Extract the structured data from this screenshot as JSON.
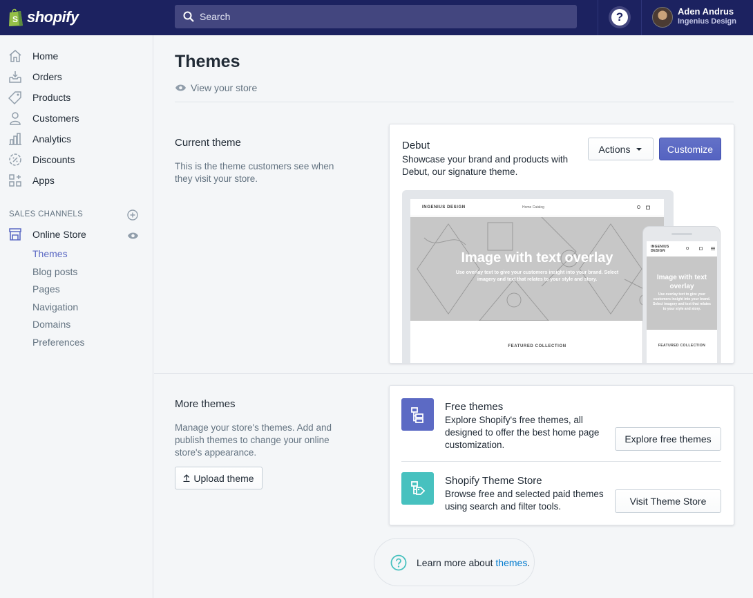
{
  "brand": {
    "name": "shopify"
  },
  "search": {
    "placeholder": "Search"
  },
  "help": {
    "label": "?"
  },
  "user": {
    "name": "Aden Andrus",
    "store": "Ingenius Design"
  },
  "sidebar": {
    "items": [
      {
        "label": "Home",
        "icon": "home-icon"
      },
      {
        "label": "Orders",
        "icon": "orders-icon"
      },
      {
        "label": "Products",
        "icon": "tag-icon"
      },
      {
        "label": "Customers",
        "icon": "person-icon"
      },
      {
        "label": "Analytics",
        "icon": "bar-chart-icon"
      },
      {
        "label": "Discounts",
        "icon": "discount-icon"
      },
      {
        "label": "Apps",
        "icon": "apps-icon"
      }
    ],
    "sales_channels_title": "SALES CHANNELS",
    "online_store": "Online Store",
    "sub_items": [
      "Themes",
      "Blog posts",
      "Pages",
      "Navigation",
      "Domains",
      "Preferences"
    ],
    "active_sub": "Themes"
  },
  "page": {
    "title": "Themes",
    "view_store": "View your store"
  },
  "current_theme": {
    "section_title": "Current theme",
    "section_desc": "This is the theme customers see when they visit your store.",
    "name": "Debut",
    "desc": "Showcase your brand and products with Debut, our signature theme.",
    "actions_label": "Actions",
    "customize_label": "Customize",
    "preview": {
      "brand": "INGENIUS DESIGN",
      "nav_links": "Home    Catalog",
      "hero_title": "Image with text overlay",
      "hero_sub": "Use overlay text to give your customers insight into your brand. Select imagery and text that relates to your style and story.",
      "featured": "FEATURED COLLECTION"
    }
  },
  "more_themes": {
    "section_title": "More themes",
    "section_desc": "Manage your store's themes. Add and publish themes to change your online store's appearance.",
    "upload_label": "Upload theme",
    "free": {
      "title": "Free themes",
      "desc": "Explore Shopify's free themes, all designed to offer the best home page customization.",
      "button": "Explore free themes",
      "icon_color": "#5c6ac4"
    },
    "store": {
      "title": "Shopify Theme Store",
      "desc": "Browse free and selected paid themes using search and filter tools.",
      "button": "Visit Theme Store",
      "icon_color": "#47c1bf"
    }
  },
  "learn": {
    "prefix": "Learn more about ",
    "link": "themes",
    "suffix": "."
  },
  "colors": {
    "topbar": "#1c2260",
    "accent": "#5c6ac4",
    "teal": "#47c1bf",
    "link": "#007ace"
  }
}
